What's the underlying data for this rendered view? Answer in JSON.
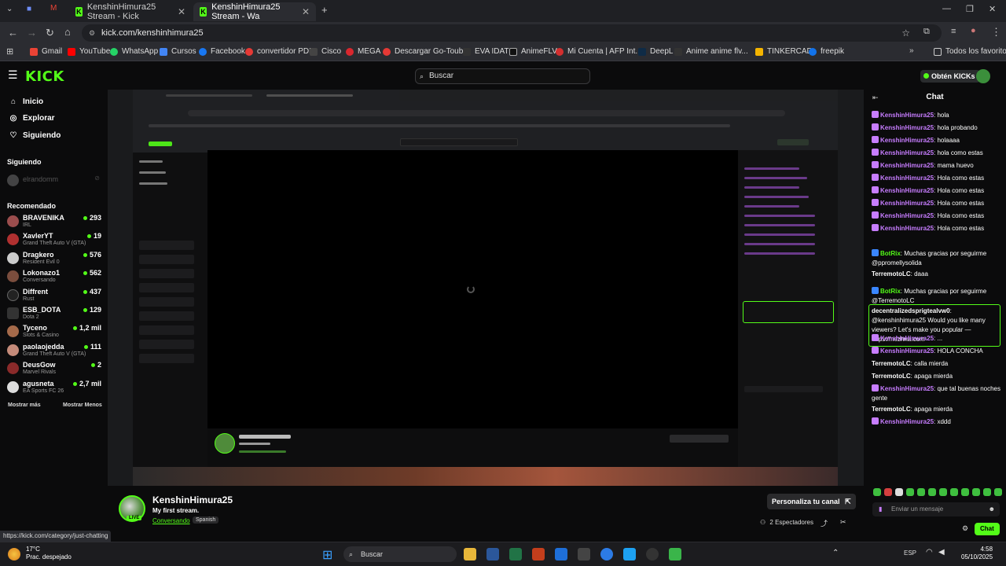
{
  "browser": {
    "tabs": [
      {
        "label": "KenshinHimura25 Stream - Kick",
        "active": false
      },
      {
        "label": "KenshinHimura25 Stream - Wa",
        "active": true
      }
    ],
    "url": "kick.com/kenshinhimura25",
    "bookmarks": [
      "Gmail",
      "YouTube",
      "WhatsApp",
      "Cursos",
      "Facebook",
      "convertidor PDF",
      "Cisco",
      "MEGA",
      "Descargar Go-Toub...",
      "EVA IDAT",
      "AnimeFLV",
      "Mi Cuenta | AFP Int...",
      "DeepL",
      "Anime anime flv...",
      "TINKERCAD",
      "freepik"
    ],
    "bookmarks_folder": "Todos los favoritos",
    "status_link": "https://kick.com/category/just-chatting"
  },
  "kick": {
    "logo": "KICK",
    "search_placeholder": "Buscar",
    "get_kicks": "Obtén KICKs"
  },
  "sidebar": {
    "nav": [
      {
        "label": "Inicio",
        "icon": "home-icon"
      },
      {
        "label": "Explorar",
        "icon": "compass-icon"
      },
      {
        "label": "Siguiendo",
        "icon": "heart-icon"
      }
    ],
    "following_title": "Siguiendo",
    "following_user": "elrandomm",
    "recommended_title": "Recomendado",
    "recommended": [
      {
        "name": "BRAVENIKA",
        "category": "IRL",
        "viewers": "293"
      },
      {
        "name": "XavlerYT",
        "category": "Grand Theft Auto V (GTA)",
        "viewers": "19"
      },
      {
        "name": "Dragkero",
        "category": "Resident Evil 0",
        "viewers": "576"
      },
      {
        "name": "Lokonazo1",
        "category": "Conversando",
        "viewers": "562"
      },
      {
        "name": "Diffrent",
        "category": "Rust",
        "viewers": "437"
      },
      {
        "name": "ESB_DOTA",
        "category": "Dota 2",
        "viewers": "129"
      },
      {
        "name": "Tyceno",
        "category": "Slots & Casino",
        "viewers": "1,2 mil"
      },
      {
        "name": "paolaojedda",
        "category": "Grand Theft Auto V (GTA)",
        "viewers": "111"
      },
      {
        "name": "DeusGow",
        "category": "Marvel Rivals",
        "viewers": "2"
      },
      {
        "name": "agusneta",
        "category": "EA Sports FC 26",
        "viewers": "2,7 mil"
      }
    ],
    "show_more": "Mostrar más",
    "show_less": "Mostrar Menos"
  },
  "stream": {
    "streamer": "KenshinHimura25",
    "title": "My first stream.",
    "category": "Conversando",
    "language": "Spanish",
    "live_badge": "LIVE",
    "customize": "Personaliza tu canal",
    "viewers": "2 Espectadores"
  },
  "chat": {
    "title": "Chat",
    "messages": [
      {
        "user": "KenshinHimura25",
        "text": "hola"
      },
      {
        "user": "KenshinHimura25",
        "text": "hola probando"
      },
      {
        "user": "KenshinHimura25",
        "text": "holaaaa"
      },
      {
        "user": "KenshinHimura25",
        "text": "hola como estas"
      },
      {
        "user": "KenshinHimura25",
        "text": "mama huevo"
      },
      {
        "user": "KenshinHimura25",
        "text": "Hola como estas"
      },
      {
        "user": "KenshinHimura25",
        "text": "Hola como estas"
      },
      {
        "user": "KenshinHimura25",
        "text": "Hola como estas"
      },
      {
        "user": "KenshinHimura25",
        "text": "Hola como estas"
      },
      {
        "user": "KenshinHimura25",
        "text": "Hola como estas"
      },
      {
        "user": "BotRix",
        "text": "Muchas gracias por seguirme @ppromellysolida"
      },
      {
        "user": "TerremotoLC",
        "text": "daaa"
      },
      {
        "user": "BotRix",
        "text": "Muchas gracias por seguirme @TerremotoLC"
      },
      {
        "user": "decentralizedsprigtealvw0",
        "text": "@kenshinhimura25 Would you like many viewers? Let's make you popular — https://nezhna.com"
      },
      {
        "user": "KenshinHimura25",
        "text": "..."
      },
      {
        "user": "KenshinHimura25",
        "text": "HOLA CONCHA"
      },
      {
        "user": "TerremotoLC",
        "text": "calla mierda"
      },
      {
        "user": "TerremotoLC",
        "text": "apaga mierda"
      },
      {
        "user": "KenshinHimura25",
        "text": "que tal buenas noches gente"
      },
      {
        "user": "TerremotoLC",
        "text": "apaga mierda"
      },
      {
        "user": "KenshinHimura25",
        "text": "xddd"
      }
    ],
    "input_placeholder": "Enviar un mensaje",
    "send": "Chat"
  },
  "taskbar": {
    "weather_temp": "17°C",
    "weather_desc": "Prac. despejado",
    "search": "Buscar",
    "lang": "ESP",
    "time": "4:58",
    "date": "05/10/2025"
  },
  "colors": {
    "kick_green": "#53fc18",
    "chat_user": "#c77dff"
  }
}
